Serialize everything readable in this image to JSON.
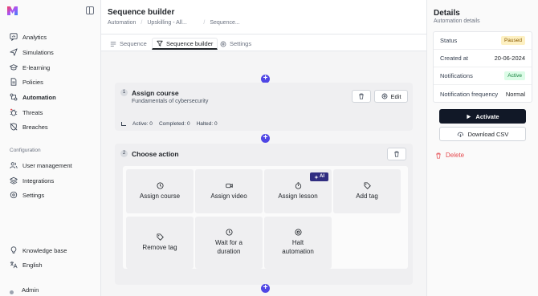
{
  "sidebar": {
    "items": [
      {
        "label": "Analytics",
        "icon": "chat-chart-icon"
      },
      {
        "label": "Simulations",
        "icon": "send-icon"
      },
      {
        "label": "E-learning",
        "icon": "graduation-cap-icon"
      },
      {
        "label": "Policies",
        "icon": "document-icon"
      },
      {
        "label": "Automation",
        "icon": "workflow-icon"
      },
      {
        "label": "Threats",
        "icon": "bug-icon"
      },
      {
        "label": "Breaches",
        "icon": "shield-off-icon"
      }
    ],
    "configuration_label": "Configuration",
    "config_items": [
      {
        "label": "User management",
        "icon": "users-icon"
      },
      {
        "label": "Integrations",
        "icon": "layers-icon"
      },
      {
        "label": "Settings",
        "icon": "gear-icon"
      }
    ],
    "bottom_items": [
      {
        "label": "Knowledge base",
        "icon": "lightbulb-icon"
      },
      {
        "label": "English",
        "icon": "language-icon"
      }
    ],
    "user_label": "Admin"
  },
  "header": {
    "title": "Sequence builder",
    "breadcrumb": [
      "Automation",
      "Upskilling - All...",
      "Sequence..."
    ]
  },
  "tabs": [
    {
      "label": "Sequence",
      "active": false
    },
    {
      "label": "Sequence builder",
      "active": true
    },
    {
      "label": "Settings",
      "active": false
    }
  ],
  "step1": {
    "number": "1",
    "title": "Assign course",
    "subtitle": "Fundamentals of cybersecurity",
    "edit_label": "Edit",
    "stats": {
      "active": "Active: 0",
      "completed": "Completed: 0",
      "halted": "Halted: 0"
    }
  },
  "step2": {
    "number": "2",
    "title": "Choose action",
    "ai_label": "AI",
    "actions": [
      {
        "label": "Assign course",
        "icon": "clock-icon"
      },
      {
        "label": "Assign video",
        "icon": "video-icon"
      },
      {
        "label": "Assign lesson",
        "icon": "timer-icon"
      },
      {
        "label": "Add tag",
        "icon": "tag-icon"
      },
      {
        "label": "Remove tag",
        "icon": "tag-icon"
      },
      {
        "label": "Wait for a duration",
        "icon": "clock-icon"
      },
      {
        "label": "Halt automation",
        "icon": "stop-circle-icon"
      }
    ]
  },
  "details": {
    "title": "Details",
    "subtitle": "Automation details",
    "rows": [
      {
        "label": "Status",
        "value": "Paused",
        "kind": "badge",
        "bg": "#fdf0c2",
        "fg": "#8a5a00"
      },
      {
        "label": "Created at",
        "value": "20-06-2024",
        "kind": "text"
      },
      {
        "label": "Notifications",
        "value": "Active",
        "kind": "badge",
        "bg": "#dcfce7",
        "fg": "#15803d"
      },
      {
        "label": "Notification frequency",
        "value": "Normal",
        "kind": "text"
      }
    ],
    "activate_label": "Activate",
    "download_label": "Download CSV",
    "delete_label": "Delete"
  },
  "colors": {
    "accent": "#4f46e5",
    "primary_button": "#111827",
    "danger": "#e5484d",
    "ai_badge": "#312e81"
  }
}
